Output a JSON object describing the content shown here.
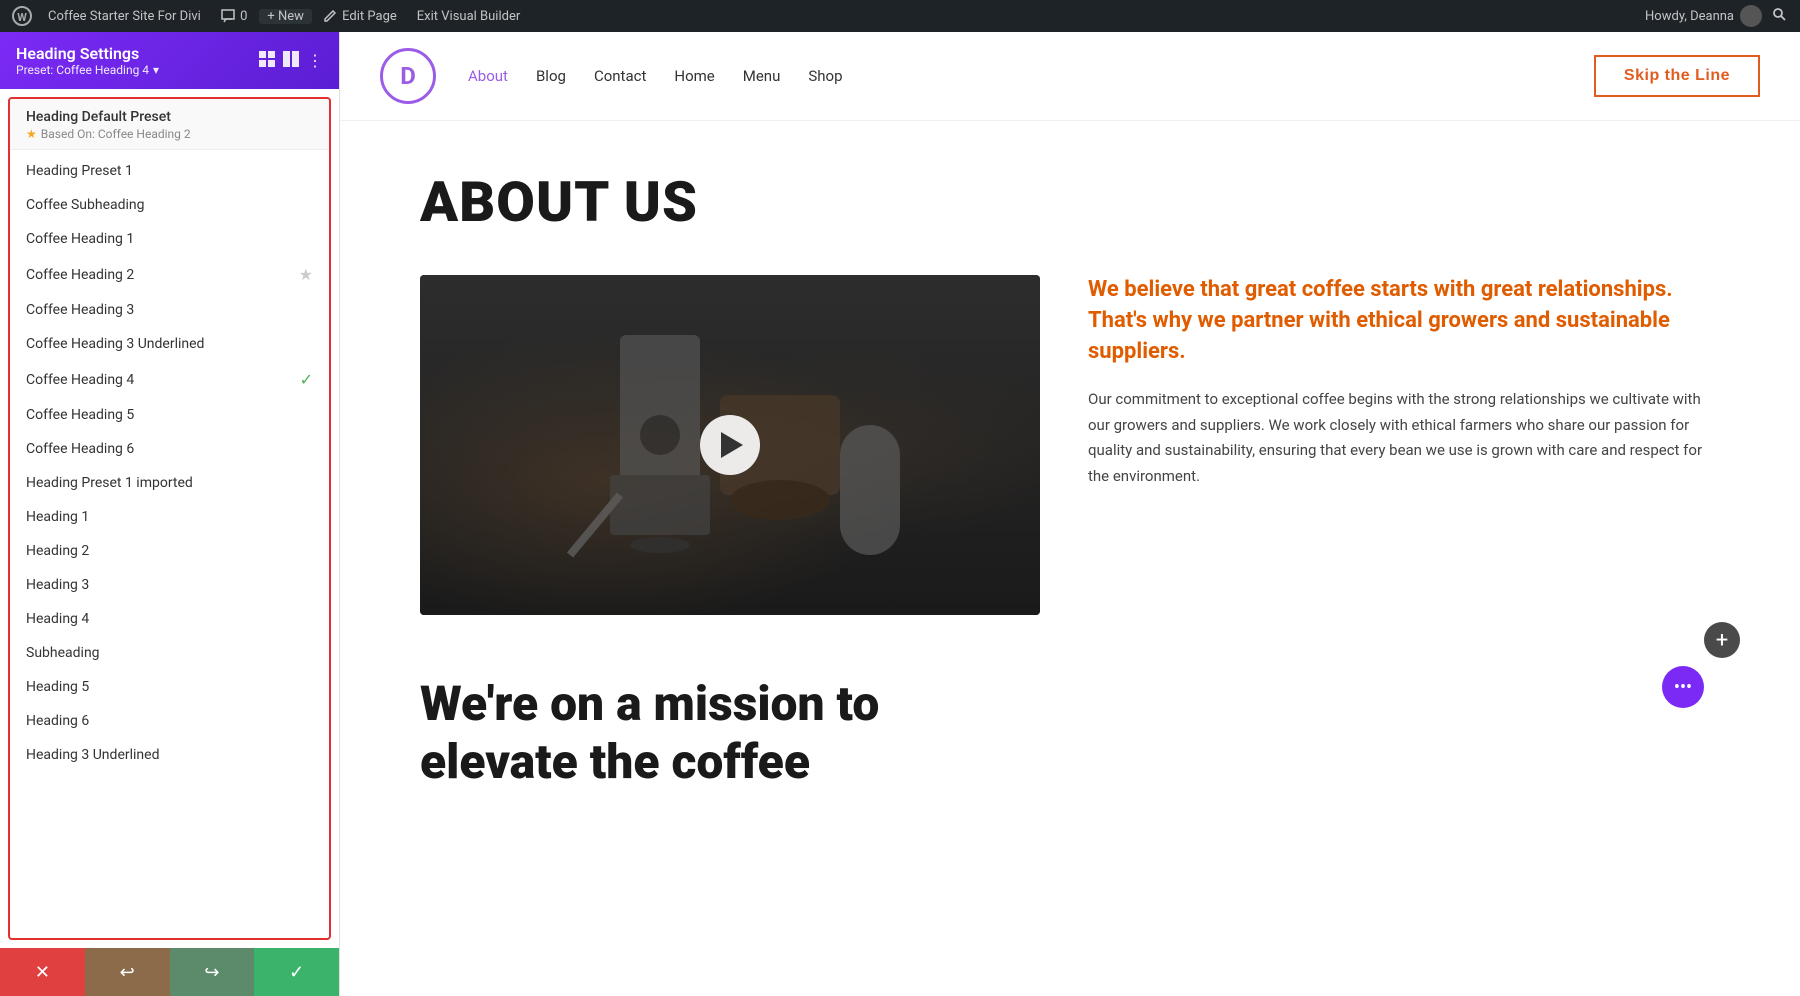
{
  "admin_bar": {
    "wp_logo": "W",
    "site_name": "Coffee Starter Site For Divi",
    "comment_count": "0",
    "new_label": "+ New",
    "edit_page": "Edit Page",
    "exit_builder": "Exit Visual Builder",
    "howdy": "Howdy, Deanna"
  },
  "sidebar": {
    "title": "Heading Settings",
    "preset_label": "Preset: Coffee Heading 4",
    "preset_chevron": "▾",
    "default_group": {
      "title": "Heading Default Preset",
      "based_on": "Based On: Coffee Heading 2"
    },
    "presets": [
      {
        "name": "Heading Preset 1",
        "star": false,
        "check": false
      },
      {
        "name": "Coffee Subheading",
        "star": false,
        "check": false
      },
      {
        "name": "Coffee Heading 1",
        "star": false,
        "check": false
      },
      {
        "name": "Coffee Heading 2",
        "star": true,
        "check": false
      },
      {
        "name": "Coffee Heading 3",
        "star": false,
        "check": false
      },
      {
        "name": "Coffee Heading 3 Underlined",
        "star": false,
        "check": false
      },
      {
        "name": "Coffee Heading 4",
        "star": false,
        "check": true
      },
      {
        "name": "Coffee Heading 5",
        "star": false,
        "check": false
      },
      {
        "name": "Coffee Heading 6",
        "star": false,
        "check": false
      },
      {
        "name": "Heading Preset 1 imported",
        "star": false,
        "check": false
      },
      {
        "name": "Heading 1",
        "star": false,
        "check": false
      },
      {
        "name": "Heading 2",
        "star": false,
        "check": false
      },
      {
        "name": "Heading 3",
        "star": false,
        "check": false
      },
      {
        "name": "Heading 4",
        "star": false,
        "check": false
      },
      {
        "name": "Subheading",
        "star": false,
        "check": false
      },
      {
        "name": "Heading 5",
        "star": false,
        "check": false
      },
      {
        "name": "Heading 6",
        "star": false,
        "check": false
      },
      {
        "name": "Heading 3 Underlined",
        "star": false,
        "check": false
      }
    ],
    "bottom": {
      "cancel": "✕",
      "undo": "↩",
      "redo": "↪",
      "save": "✓"
    }
  },
  "site": {
    "logo_letter": "D",
    "nav_items": [
      "About",
      "Blog",
      "Contact",
      "Home",
      "Menu",
      "Shop"
    ],
    "nav_active": "About",
    "cta_button": "Skip the Line"
  },
  "page": {
    "hero_heading": "ABOUT US",
    "orange_quote": "We believe that great coffee starts with great relationships. That's why we partner with ethical growers and sustainable suppliers.",
    "body_text": "Our commitment to exceptional coffee begins with the strong relationships we cultivate with our growers and suppliers. We work closely with ethical farmers who share our passion for quality and sustainability, ensuring that every bean we use is grown with care and respect for the environment.",
    "mission_heading_line1": "We're on a mission to",
    "mission_heading_line2": "elevate the coffee"
  }
}
